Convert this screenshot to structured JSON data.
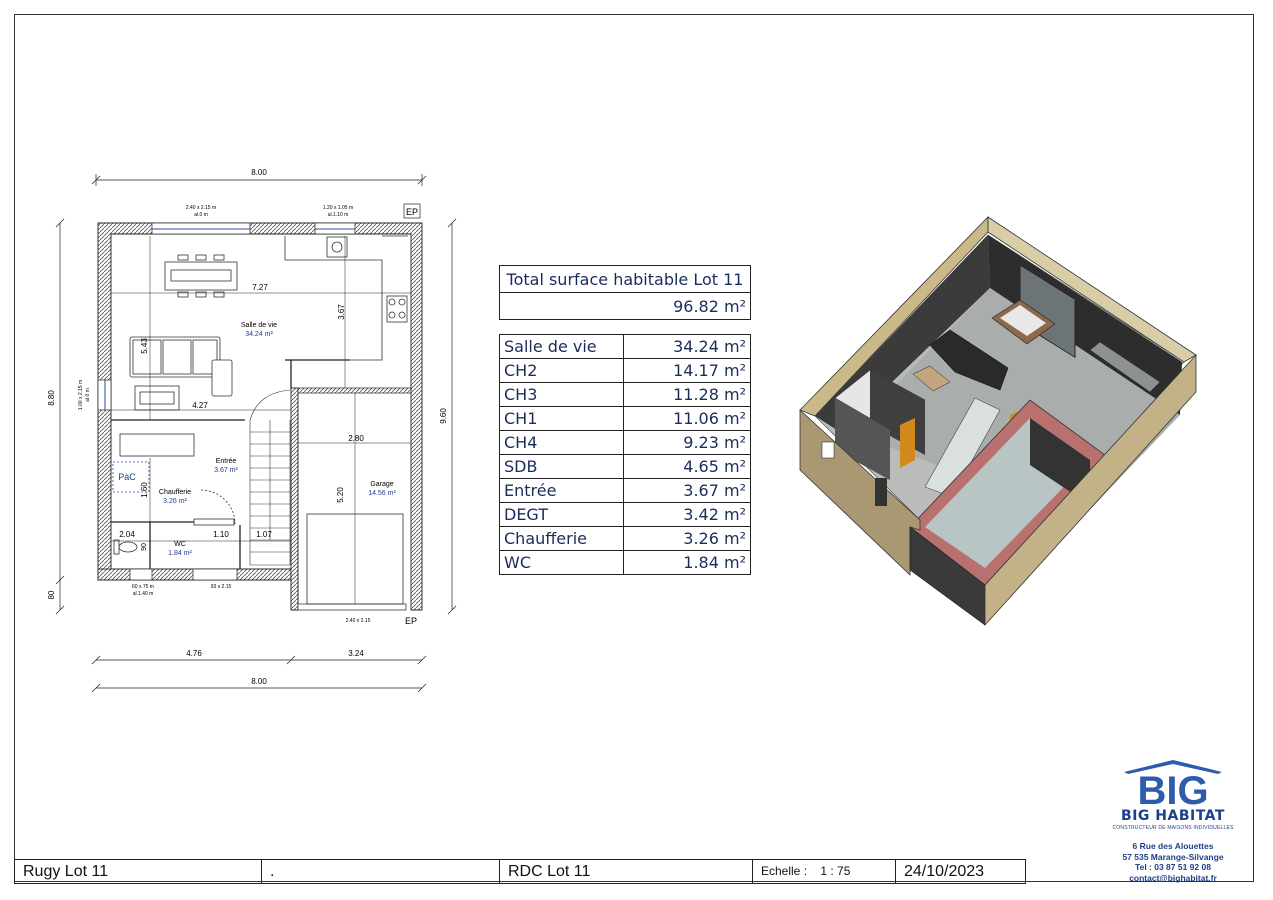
{
  "plan": {
    "overall_width_top": "8.00",
    "window_top_left": {
      "size": "2.40 x 2.15 m",
      "sill": "al.0 m"
    },
    "window_top_right": {
      "size": "1.20 x 1.05 m",
      "sill": "al.1.10 m"
    },
    "ep_top": "EP",
    "ep_bottom": "EP",
    "height_left": "8.80",
    "height_right": "9.60",
    "height_bottom_left": "80",
    "window_left": {
      "size": "1.00 x 2.15 m",
      "sill": "al.0 m"
    },
    "dim_727": "7.27",
    "dim_367": "3.67",
    "dim_543": "5.43",
    "dim_427": "4.27",
    "dim_280": "2.80",
    "dim_520": "5.20",
    "dim_160": "1.60",
    "dim_204": "2.04",
    "dim_110": "1.10",
    "dim_107": "1.07",
    "dim_90": "90",
    "rooms": {
      "salle": {
        "name": "Salle de vie",
        "area": "34.24 m²"
      },
      "entree": {
        "name": "Entrée",
        "area": "3.67 m²"
      },
      "chauff": {
        "name": "Chaufferie",
        "area": "3.26 m²"
      },
      "wc": {
        "name": "WC",
        "area": "1.84 m²"
      },
      "garage": {
        "name": "Garage",
        "area": "14.56 m²"
      },
      "pac": "PàC"
    },
    "window_bottom_left": {
      "size": "60 x 75 m",
      "sill": "al.1.40 m"
    },
    "door_bottom": "93 x 2.15",
    "garage_door": "2.40 x 2.15",
    "dim_476": "4.76",
    "dim_324": "3.24",
    "overall_width_bottom": "8.00"
  },
  "total": {
    "title": "Total surface habitable Lot 11",
    "value": "96.82 m²"
  },
  "rooms_table": [
    {
      "name": "Salle de vie",
      "area": "34.24 m²"
    },
    {
      "name": "CH2",
      "area": "14.17 m²"
    },
    {
      "name": "CH3",
      "area": "11.28 m²"
    },
    {
      "name": "CH1",
      "area": "11.06 m²"
    },
    {
      "name": "CH4",
      "area": "9.23 m²"
    },
    {
      "name": "SDB",
      "area": "4.65 m²"
    },
    {
      "name": "Entrée",
      "area": "3.67 m²"
    },
    {
      "name": "DEGT",
      "area": "3.42 m²"
    },
    {
      "name": "Chaufferie",
      "area": "3.26 m²"
    },
    {
      "name": "WC",
      "area": "1.84 m²"
    }
  ],
  "footer": {
    "project": "Rugy Lot 11",
    "blank": ".",
    "level": "RDC Lot 11",
    "scale_label": "Echelle :",
    "scale_value": "1 : 75",
    "date": "24/10/2023"
  },
  "brand": {
    "logo_text": "BIG",
    "name": "BIG HABITAT",
    "tagline": "CONSTRUCTEUR DE MAISONS INDIVIDUELLES",
    "address1": "6 Rue des Alouettes",
    "address2": "57 535 Marange-Silvange",
    "phone": "Tel : 03 87 51 92 08",
    "email": "contact@bighabitat.fr"
  },
  "colors": {
    "accent_blue": "#1c3f8a",
    "table_text": "#1a2c5a",
    "wall_hatch": "#555555"
  }
}
